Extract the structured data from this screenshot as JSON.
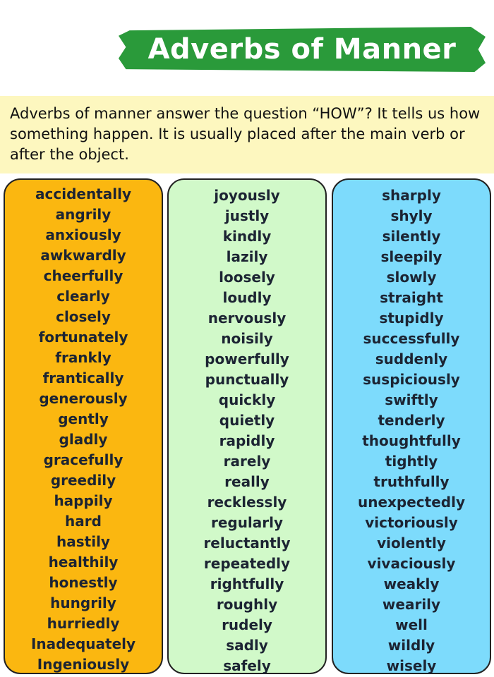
{
  "title": "Adverbs of Manner",
  "intro": {
    "term": "Adverbs of manner",
    "rest": " answer the question “HOW”? It tells us how something happen. It is usually placed after the main verb or after the object."
  },
  "colors": {
    "banner": "#2a9a3a",
    "intro_background": "#fdf7bf",
    "column_1": "#fbb710",
    "column_2": "#d1f9c9",
    "column_3": "#7ddbfc"
  },
  "columns": [
    {
      "words": [
        "accidentally",
        "angrily",
        "anxiously",
        "awkwardly",
        "cheerfully",
        "clearly",
        "closely",
        "fortunately",
        "frankly",
        "frantically",
        "generously",
        "gently",
        "gladly",
        "gracefully",
        "greedily",
        "happily",
        "hard",
        "hastily",
        "healthily",
        "honestly",
        "hungrily",
        "hurriedly",
        "Inadequately",
        "Ingeniously"
      ]
    },
    {
      "words": [
        "joyously",
        "justly",
        "kindly",
        "lazily",
        "loosely",
        "loudly",
        "nervously",
        "noisily",
        "powerfully",
        "punctually",
        "quickly",
        "quietly",
        "rapidly",
        "rarely",
        "really",
        "recklessly",
        "regularly",
        "reluctantly",
        "repeatedly",
        "rightfully",
        "roughly",
        "rudely",
        "sadly",
        "safely"
      ]
    },
    {
      "words": [
        "sharply",
        "shyly",
        "silently",
        "sleepily",
        "slowly",
        "straight",
        "stupidly",
        "successfully",
        "suddenly",
        "suspiciously",
        "swiftly",
        "tenderly",
        "thoughtfully",
        "tightly",
        "truthfully",
        "unexpectedly",
        "victoriously",
        "violently",
        "vivaciously",
        "weakly",
        "wearily",
        "well",
        "wildly",
        "wisely"
      ]
    }
  ]
}
